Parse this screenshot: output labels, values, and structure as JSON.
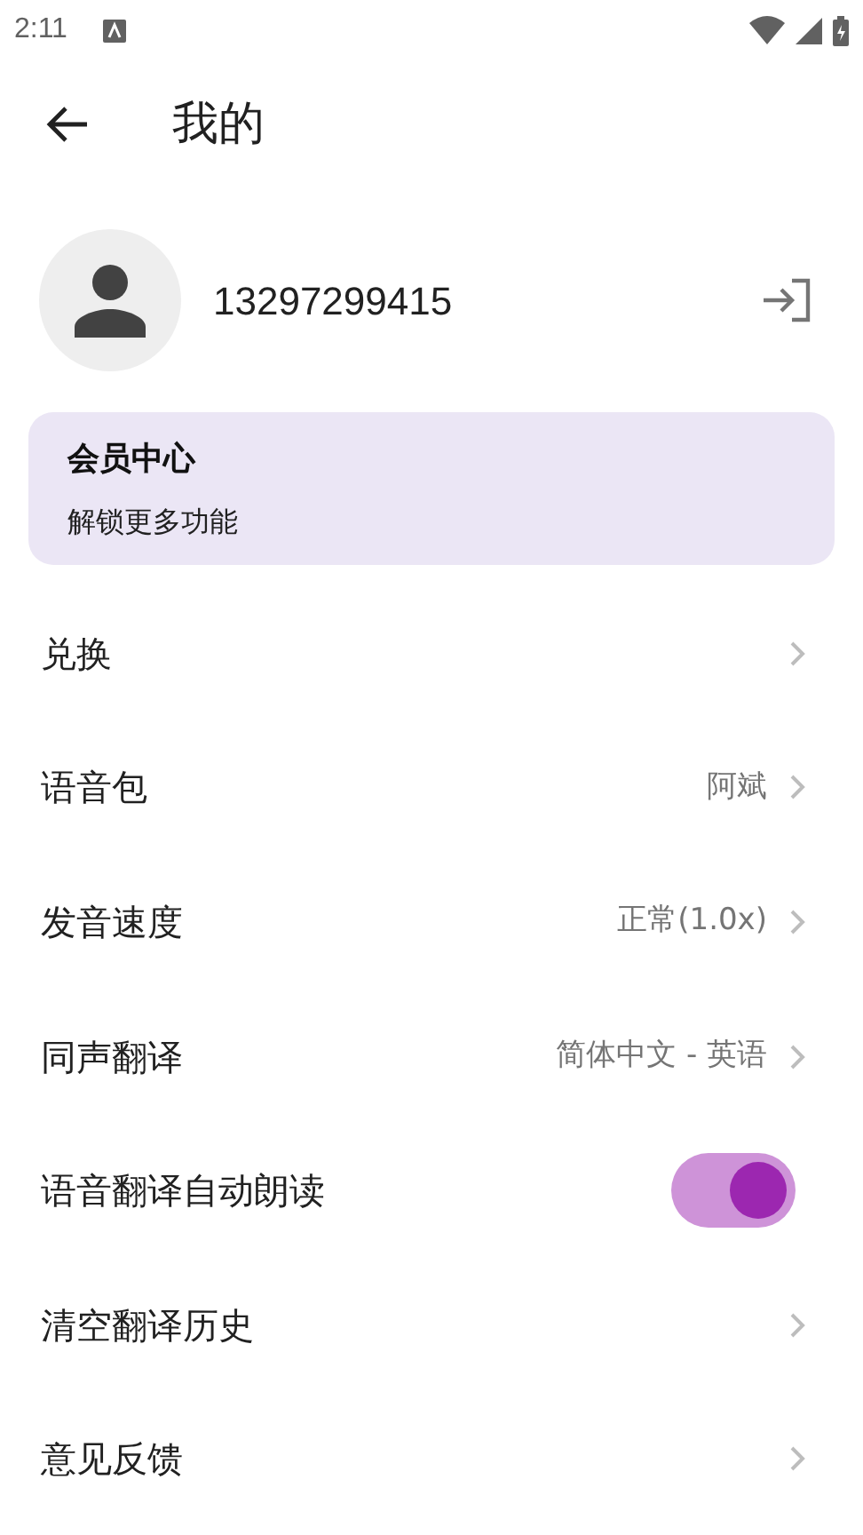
{
  "status_bar": {
    "time": "2:11"
  },
  "header": {
    "title": "我的"
  },
  "profile": {
    "phone": "13297299415"
  },
  "vip_card": {
    "title": "会员中心",
    "subtitle": "解锁更多功能"
  },
  "settings": [
    {
      "kind": "link",
      "label": "兑换"
    },
    {
      "kind": "link",
      "label": "语音包",
      "value": "阿斌"
    },
    {
      "kind": "link",
      "label": "发音速度",
      "value": "正常(1.0x)"
    },
    {
      "kind": "link",
      "label": "同声翻译",
      "value": "简体中文 - 英语"
    },
    {
      "kind": "toggle",
      "label": "语音翻译自动朗读",
      "on": true
    },
    {
      "kind": "link",
      "label": "清空翻译历史"
    },
    {
      "kind": "link",
      "label": "意见反馈"
    }
  ]
}
